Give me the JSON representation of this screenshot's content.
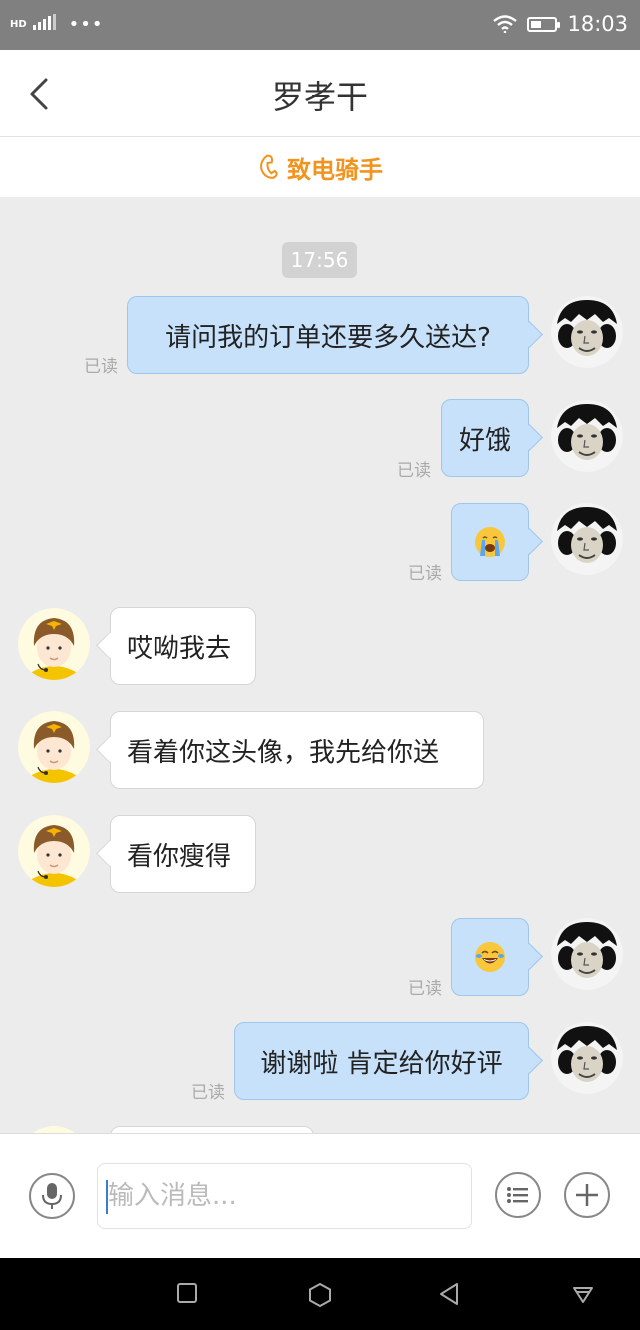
{
  "status_bar": {
    "network_label": "HD",
    "time": "18:03",
    "battery_level": 0.45,
    "icons": [
      "signal-icon",
      "more-dots-icon",
      "wifi-icon",
      "battery-icon"
    ]
  },
  "header": {
    "title": "罗孝干",
    "back_icon": "chevron-left-icon"
  },
  "call_bar": {
    "label": "致电骑手",
    "icon": "phone-icon",
    "color": "#f0941f"
  },
  "chat": {
    "timestamp": "17:56",
    "messages": [
      {
        "from": "me",
        "text": "请问我的订单还要多久送达?",
        "status": "已读"
      },
      {
        "from": "me",
        "text": "好饿",
        "status": "已读"
      },
      {
        "from": "me",
        "emoji": "crying-face-emoji",
        "status": "已读"
      },
      {
        "from": "rider",
        "text": "哎呦我去"
      },
      {
        "from": "rider",
        "text": "看着你这头像，我先给你送"
      },
      {
        "from": "rider",
        "text": "看你瘦得"
      },
      {
        "from": "me",
        "emoji": "tears-of-joy-emoji",
        "status": "已读"
      },
      {
        "from": "me",
        "text": "谢谢啦 肯定给你好评",
        "status": "已读"
      }
    ]
  },
  "input_bar": {
    "placeholder": "输入消息...",
    "icons": [
      "microphone-icon",
      "list-icon",
      "plus-icon"
    ]
  },
  "system_nav": {
    "icons": [
      "square-icon",
      "hexagon-icon",
      "back-triangle-icon",
      "notification-down-icon"
    ]
  },
  "colors": {
    "my_bubble": "#c7e1fb",
    "rider_bubble": "#ffffff",
    "background": "#ececec",
    "accent": "#f0941f"
  }
}
